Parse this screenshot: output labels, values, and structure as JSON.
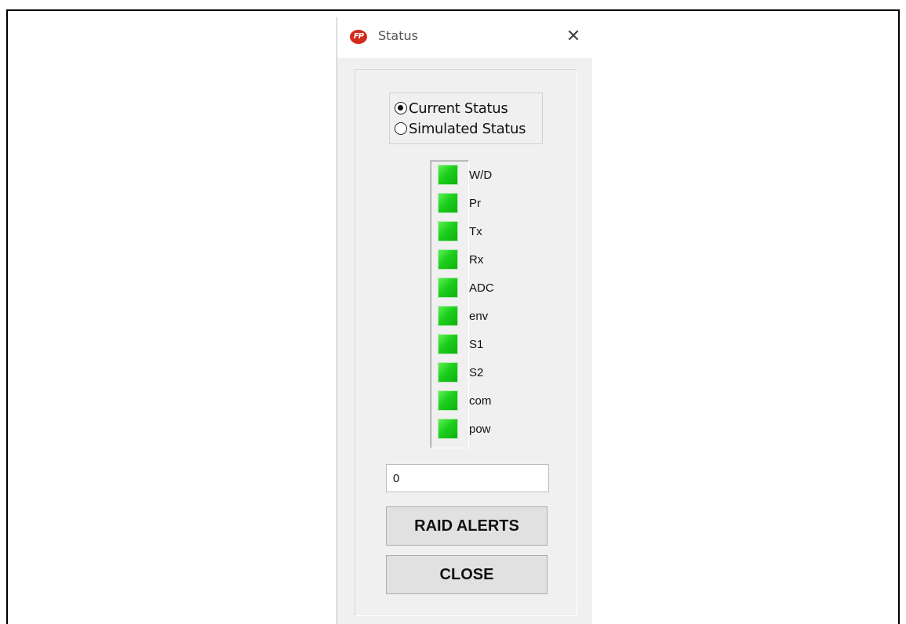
{
  "window": {
    "title": "Status",
    "app_icon_text": "FP",
    "close_glyph": "✕",
    "icons": {
      "app": "app-logo-icon",
      "close": "close-icon"
    }
  },
  "status_mode": {
    "options": [
      {
        "label": "Current Status",
        "selected": true
      },
      {
        "label": "Simulated Status",
        "selected": false
      }
    ]
  },
  "indicators": [
    {
      "label": "W/D",
      "state": "ok"
    },
    {
      "label": "Pr",
      "state": "ok"
    },
    {
      "label": "Tx",
      "state": "ok"
    },
    {
      "label": "Rx",
      "state": "ok"
    },
    {
      "label": "ADC",
      "state": "ok"
    },
    {
      "label": "env",
      "state": "ok"
    },
    {
      "label": "S1",
      "state": "ok"
    },
    {
      "label": "S2",
      "state": "ok"
    },
    {
      "label": "com",
      "state": "ok"
    },
    {
      "label": "pow",
      "state": "ok"
    }
  ],
  "value_field": {
    "value": "0"
  },
  "buttons": {
    "raid_alerts": "RAID ALERTS",
    "close": "CLOSE"
  },
  "colors": {
    "led_ok": "#1ccf1a",
    "app_icon": "#d32a1d"
  }
}
